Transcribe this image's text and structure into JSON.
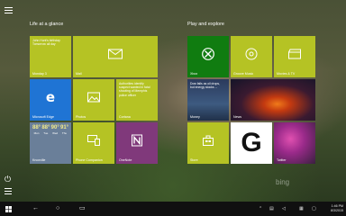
{
  "start": {
    "group_left_title": "Life at a glance",
    "group_right_title": "Play and explore",
    "watermark": "bing"
  },
  "tiles": {
    "calendar": {
      "event": "John Hunt's birthday Tomorrow all day",
      "label": "Monday 3"
    },
    "mail": {
      "label": "Mail"
    },
    "edge": {
      "label": "Microsoft Edge"
    },
    "photos": {
      "label": "Photos"
    },
    "cortana": {
      "text": "Authorities identify suspect wanted in fatal shooting of Memphis police officer",
      "label": "Cortana"
    },
    "weather": {
      "label": "Knoxville",
      "days": [
        {
          "day": "Mon",
          "hi": "88°",
          "lo": "70°"
        },
        {
          "day": "Tue",
          "hi": "88°",
          "lo": "70°"
        },
        {
          "day": "Wed",
          "hi": "90°",
          "lo": "72°"
        },
        {
          "day": "Thu",
          "hi": "91°",
          "lo": "71°"
        },
        {
          "day": "Fri",
          "hi": "89°",
          "lo": "70°"
        }
      ]
    },
    "phone": {
      "label": "Phone Companion"
    },
    "onenote": {
      "label": "OneNote"
    },
    "xbox": {
      "label": "Xbox"
    },
    "groove": {
      "label": "Groove Music"
    },
    "movies": {
      "label": "Movies & TV"
    },
    "money": {
      "text": "Dow falls as oil drops, but energy stocks ...",
      "label": "Money"
    },
    "news": {
      "label": "News"
    },
    "store": {
      "label": "Store"
    },
    "getstarted": {
      "letter": "G"
    },
    "twitter": {
      "label": "Twitter"
    }
  },
  "taskbar": {
    "time": "1:46 PM",
    "date": "8/3/2015"
  },
  "colors": {
    "tile_lime": "#b5c324",
    "edge_blue": "#1f74d4",
    "onenote_purple": "#80397b",
    "xbox_green": "#107c10"
  }
}
